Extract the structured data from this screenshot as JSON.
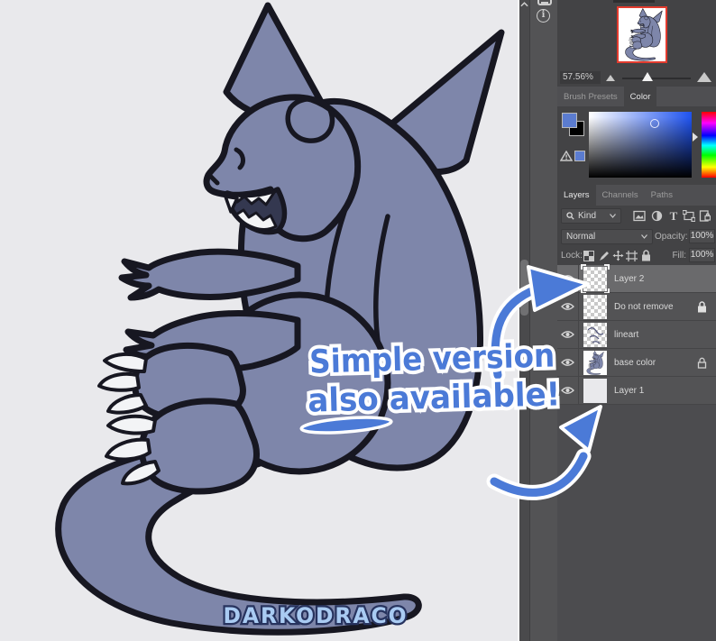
{
  "canvas": {
    "background": "#e9e9ec",
    "character_color": "#7e86aa",
    "outline_color": "#171721",
    "annotation": {
      "line1": "Simple version",
      "line2": "also available!",
      "color": "#4b7ad7",
      "outline": "#ffffff"
    },
    "watermark": {
      "text": "DARKODRACO",
      "color": "#a9cbf2",
      "outline": "#27335e"
    }
  },
  "navigator": {
    "zoom": "57.56%",
    "thumbnail_border": "#e23b2e"
  },
  "tabs_top": [
    {
      "label": "Brush Presets",
      "active": false
    },
    {
      "label": "Color",
      "active": true
    }
  ],
  "color_panel": {
    "foreground": "#5b7cd0",
    "background_swatch": "#000000",
    "picker_blue": "#1e52ee"
  },
  "tabs_layers": [
    {
      "label": "Layers",
      "active": true
    },
    {
      "label": "Channels",
      "active": false
    },
    {
      "label": "Paths",
      "active": false
    }
  ],
  "layers_panel": {
    "filter_label": "Kind",
    "blend_mode": "Normal",
    "opacity_label": "Opacity:",
    "opacity_value": "100%",
    "lock_label": "Lock:",
    "fill_label": "Fill:",
    "fill_value": "100%",
    "layers": [
      {
        "name": "Layer 2",
        "selected": true,
        "lock": "none"
      },
      {
        "name": "Do not remove",
        "selected": false,
        "lock": "full"
      },
      {
        "name": "lineart",
        "selected": false,
        "lock": "none"
      },
      {
        "name": "base color",
        "selected": false,
        "lock": "transparency"
      },
      {
        "name": "Layer 1",
        "selected": false,
        "lock": "none"
      }
    ]
  },
  "icons": {
    "type_filter": "T",
    "info": "i"
  }
}
